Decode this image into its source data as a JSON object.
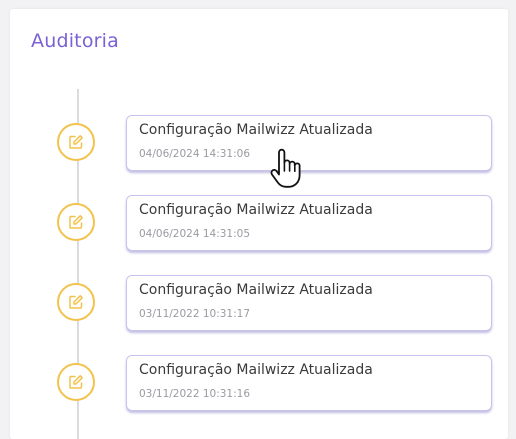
{
  "panel": {
    "title": "Auditoria"
  },
  "events": [
    {
      "title": "Configuração Mailwizz Atualizada",
      "timestamp": "04/06/2024 14:31:06",
      "icon": "edit-icon"
    },
    {
      "title": "Configuração Mailwizz Atualizada",
      "timestamp": "04/06/2024 14:31:05",
      "icon": "edit-icon"
    },
    {
      "title": "Configuração Mailwizz Atualizada",
      "timestamp": "03/11/2022 10:31:17",
      "icon": "edit-icon"
    },
    {
      "title": "Configuração Mailwizz Atualizada",
      "timestamp": "03/11/2022 10:31:16",
      "icon": "edit-icon"
    }
  ],
  "colors": {
    "title": "#7b62d4",
    "icon_ring": "#f3c24b",
    "card_border": "#c9c4ee",
    "timeline": "#dcdce0"
  },
  "cursor": "hand-pointer-icon"
}
